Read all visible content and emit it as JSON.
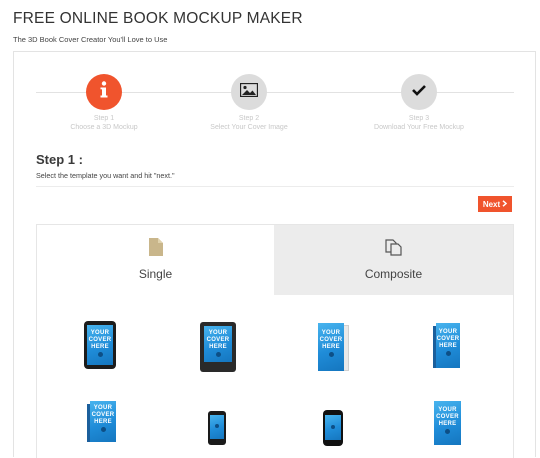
{
  "header": {
    "title": "FREE ONLINE BOOK MOCKUP MAKER",
    "subtitle": "The 3D Book Cover Creator You'll Love to Use"
  },
  "steps": [
    {
      "number": "Step 1",
      "label": "Choose a 3D Mockup",
      "icon": "info-icon",
      "state": "active"
    },
    {
      "number": "Step 2",
      "label": "Select Your Cover Image",
      "icon": "image-icon",
      "state": "inactive"
    },
    {
      "number": "Step 3",
      "label": "Download Your Free Mockup",
      "icon": "checkmark-icon",
      "state": "inactive"
    }
  ],
  "main": {
    "heading": "Step 1 :",
    "instructions": "Select the template you want and hit \"next.\"",
    "next_label": "Next"
  },
  "tabs": [
    {
      "label": "Single",
      "icon": "document-icon",
      "selected": true
    },
    {
      "label": "Composite",
      "icon": "stacked-pages-icon",
      "selected": false
    }
  ],
  "cover_text": [
    "YOUR",
    "COVER",
    "HERE"
  ],
  "colors": {
    "accent": "#f0542d",
    "cover_blue": "#1f8cd8",
    "inactive_tab": "#ececec",
    "step_gray": "#dcdcdc"
  }
}
